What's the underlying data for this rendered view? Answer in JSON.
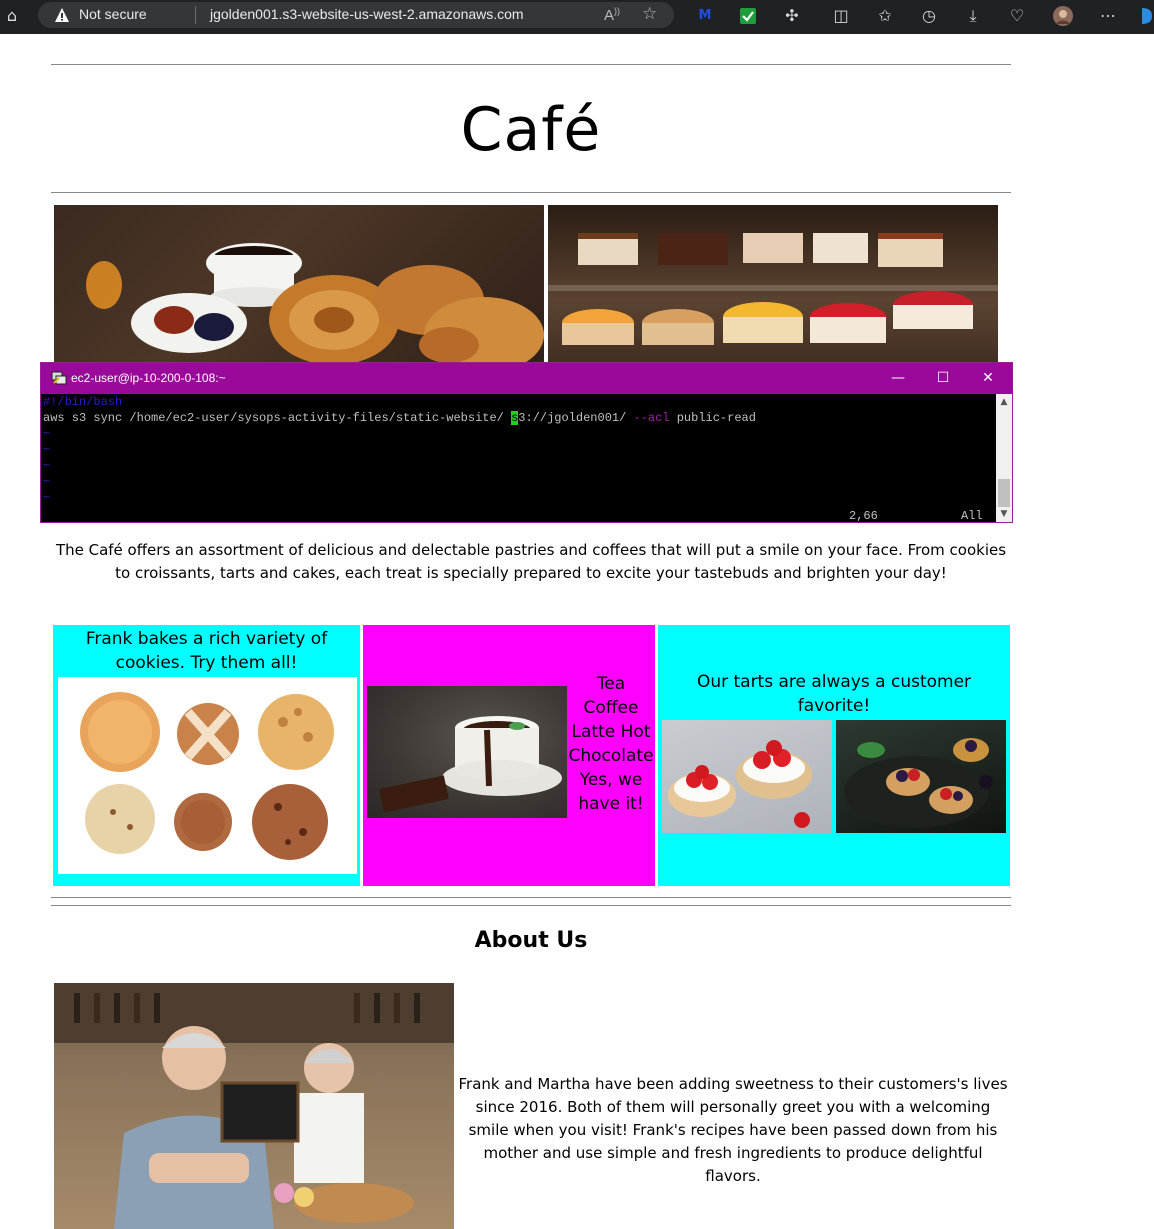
{
  "browser": {
    "security_label": "Not secure",
    "url": "jgolden001.s3-website-us-west-2.amazonaws.com"
  },
  "page": {
    "title": "Café",
    "intro": "The Café offers an assortment of delicious and delectable pastries and coffees that will put a smile on your face. From cookies to croissants, tarts and cakes, each treat is specially prepared to excite your tastebuds and brighten your day!",
    "cookies_caption": "Frank bakes a rich variety of cookies. Try them all!",
    "drinks_caption": "Tea Coffee Latte Hot Chocolate Yes, we have it!",
    "tarts_caption": "Our tarts are always a customer favorite!",
    "about_heading": "About Us",
    "about_text": "Frank and Martha have been adding sweetness to their customers's lives since 2016. Both of them will personally greet you with a welcoming smile when you visit! Frank's recipes have been passed down from his mother and use simple and fresh ingredients to produce delightful flavors."
  },
  "terminal": {
    "title": "ec2-user@ip-10-200-0-108:~",
    "line1": "#!/bin/bash",
    "cmd_a": "aws s3 sync /home/ec2-user/sysops-activity-files/static-website/ ",
    "cmd_cursor": "s",
    "cmd_b": "3://jgolden001/ ",
    "cmd_flag": "--acl",
    "cmd_c": " public-read",
    "tilde": "~",
    "position": "2,66",
    "scope": "All"
  },
  "colors": {
    "cyan_cell": "#00ffff",
    "magenta_cell": "#ff00ff",
    "terminal_titlebar": "#9a0a9a"
  }
}
